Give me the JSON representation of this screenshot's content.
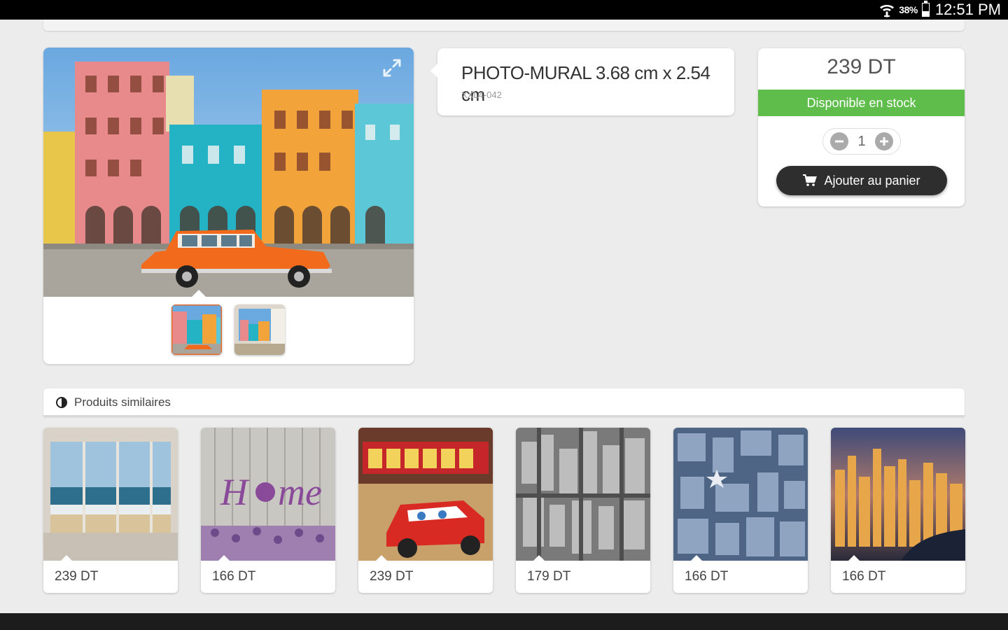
{
  "status_bar": {
    "battery_percent": "38%",
    "time": "12:51 PM"
  },
  "product": {
    "title": "PHOTO-MURAL 3.68 cm x 2.54 cm",
    "reference": "XXL4-042"
  },
  "purchase": {
    "price": "239 DT",
    "stock_status": "Disponible en stock",
    "quantity": "1",
    "add_to_cart_label": "Ajouter au panier",
    "stock_color": "#5fbe4b"
  },
  "similar": {
    "title": "Produits similaires",
    "items": [
      {
        "price": "239 DT",
        "icon": "ocean-window-image"
      },
      {
        "price": "166 DT",
        "icon": "home-lavender-image"
      },
      {
        "price": "239 DT",
        "icon": "cars-mcqueen-image"
      },
      {
        "price": "179 DT",
        "icon": "city-aerial-bw-image"
      },
      {
        "price": "166 DT",
        "icon": "city-aerial-blue-image"
      },
      {
        "price": "166 DT",
        "icon": "city-night-image"
      }
    ]
  }
}
